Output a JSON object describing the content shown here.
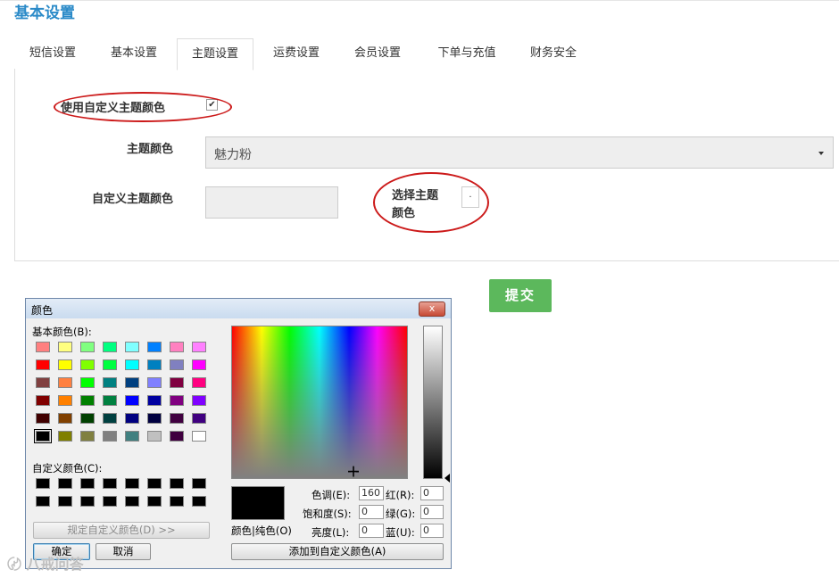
{
  "page": {
    "title": "基本设置"
  },
  "tabs": [
    {
      "label": "短信设置",
      "active": false
    },
    {
      "label": "基本设置",
      "active": false
    },
    {
      "label": "主题设置",
      "active": true
    },
    {
      "label": "运费设置",
      "active": false
    },
    {
      "label": "会员设置",
      "active": false
    },
    {
      "label": "下单与充值",
      "active": false
    },
    {
      "label": "财务安全",
      "active": false
    }
  ],
  "form": {
    "use_custom_label": "使用自定义主题颜色",
    "use_custom_checked": "✔",
    "theme_color_label": "主题颜色",
    "theme_color_value": "魅力粉",
    "custom_color_label": "自定义主题颜色",
    "pick_color_label": "选择主题颜色",
    "pick_color_button": ".",
    "submit": "提交"
  },
  "dialog": {
    "title": "颜色",
    "close": "x",
    "basic_colors_label": "基本颜色(B):",
    "custom_colors_label": "自定义颜色(C):",
    "define_custom_button": "规定自定义颜色(D) >>",
    "ok_button": "确定",
    "cancel_button": "取消",
    "color_solid_label": "颜色|纯色(O)",
    "add_custom_button": "添加到自定义颜色(A)",
    "fields": {
      "hue_label": "色调(E):",
      "hue_value": "160",
      "sat_label": "饱和度(S):",
      "sat_value": "0",
      "lum_label": "亮度(L):",
      "lum_value": "0",
      "red_label": "红(R):",
      "red_value": "0",
      "green_label": "绿(G):",
      "green_value": "0",
      "blue_label": "蓝(U):",
      "blue_value": "0"
    },
    "basic_colors": [
      [
        "#ff8080",
        "#ffff80",
        "#80ff80",
        "#00ff80",
        "#80ffff",
        "#0080ff",
        "#ff80c0",
        "#ff80ff"
      ],
      [
        "#ff0000",
        "#ffff00",
        "#80ff00",
        "#00ff40",
        "#00ffff",
        "#0080c0",
        "#8080c0",
        "#ff00ff"
      ],
      [
        "#804040",
        "#ff8040",
        "#00ff00",
        "#008080",
        "#004080",
        "#8080ff",
        "#800040",
        "#ff0080"
      ],
      [
        "#800000",
        "#ff8000",
        "#008000",
        "#008040",
        "#0000ff",
        "#0000a0",
        "#800080",
        "#8000ff"
      ],
      [
        "#400000",
        "#804000",
        "#004000",
        "#004040",
        "#000080",
        "#000040",
        "#400040",
        "#400080"
      ],
      [
        "#000000",
        "#808000",
        "#808040",
        "#808080",
        "#408080",
        "#c0c0c0",
        "#400040",
        "#ffffff"
      ]
    ],
    "custom_colors": [
      [
        "#000000",
        "#000000",
        "#000000",
        "#000000",
        "#000000",
        "#000000",
        "#000000",
        "#000000"
      ],
      [
        "#000000",
        "#000000",
        "#000000",
        "#000000",
        "#000000",
        "#000000",
        "#000000",
        "#000000"
      ]
    ]
  },
  "watermark": "八戒问答",
  "colors": {
    "accent": "#2a8ac8",
    "submit": "#5cb85c",
    "annotation": "#cc1a1a"
  }
}
